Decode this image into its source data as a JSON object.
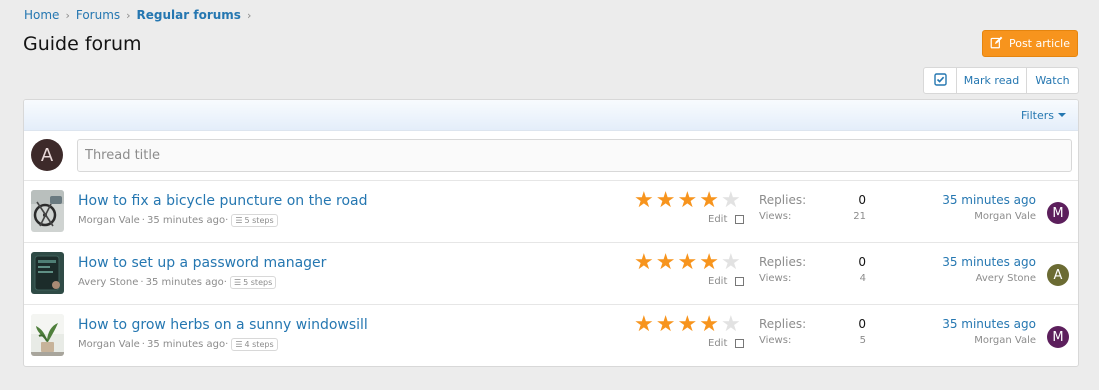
{
  "breadcrumb": [
    "Home",
    "Forums",
    "Regular forums"
  ],
  "page_title": "Guide forum",
  "actions": {
    "post_article": "Post article",
    "mark_read": "Mark read",
    "watch": "Watch"
  },
  "filters_label": "Filters",
  "quick_thread": {
    "avatar_letter": "A",
    "avatar_color": "#3d2a2a",
    "placeholder": "Thread title"
  },
  "threads": [
    {
      "title": "How to fix a bicycle puncture on the road",
      "author": "Morgan Vale",
      "time": "35 minutes ago",
      "steps": "5 steps",
      "rating": 4,
      "rating_max": 5,
      "edit": "Edit",
      "replies_label": "Replies:",
      "replies": "0",
      "views_label": "Views:",
      "views": "21",
      "last_time": "35 minutes ago",
      "last_user": "Morgan Vale",
      "last_avatar_letter": "M",
      "last_avatar_color": "#5c1f5c",
      "thumb": "bicycle"
    },
    {
      "title": "How to set up a password manager",
      "author": "Avery Stone",
      "time": "35 minutes ago",
      "steps": "5 steps",
      "rating": 4,
      "rating_max": 5,
      "edit": "Edit",
      "replies_label": "Replies:",
      "replies": "0",
      "views_label": "Views:",
      "views": "4",
      "last_time": "35 minutes ago",
      "last_user": "Avery Stone",
      "last_avatar_letter": "A",
      "last_avatar_color": "#6b6b33",
      "thumb": "phone"
    },
    {
      "title": "How to grow herbs on a sunny windowsill",
      "author": "Morgan Vale",
      "time": "35 minutes ago",
      "steps": "4 steps",
      "rating": 4,
      "rating_max": 5,
      "edit": "Edit",
      "replies_label": "Replies:",
      "replies": "0",
      "views_label": "Views:",
      "views": "5",
      "last_time": "35 minutes ago",
      "last_user": "Morgan Vale",
      "last_avatar_letter": "M",
      "last_avatar_color": "#5c1f5c",
      "thumb": "plant"
    }
  ],
  "colors": {
    "link": "#2577b1",
    "accent": "#f7941d",
    "star_off": "#e2e2e2"
  }
}
